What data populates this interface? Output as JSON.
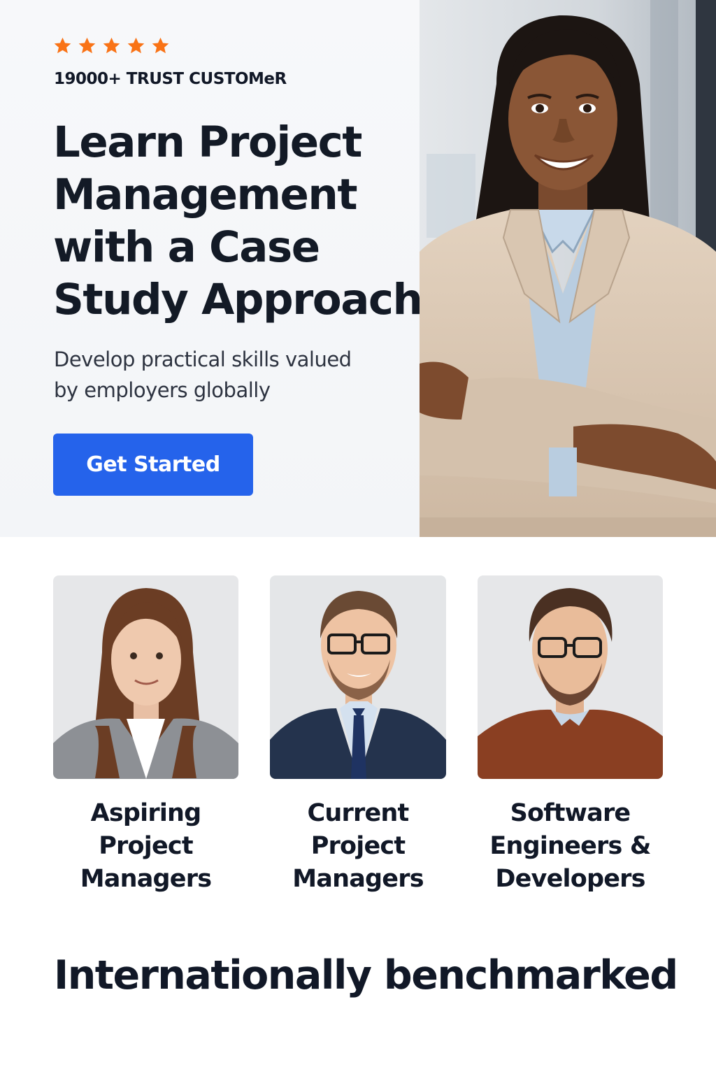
{
  "hero": {
    "rating_stars": 5,
    "star_color": "#f97316",
    "trust_text": "19000+ TRUST CUSTOMeR",
    "headline_lines": [
      "Learn Project",
      "Management",
      "with a Case",
      "Study Approach"
    ],
    "subhead_lines": [
      "Develop practical skills valued",
      "by employers globally"
    ],
    "cta_label": "Get Started",
    "cta_color": "#2563eb",
    "photo_icon": "woman-professional-portrait"
  },
  "audience": {
    "cards": [
      {
        "label_lines": [
          "Aspiring",
          "Project",
          "Managers"
        ],
        "photo_icon": "woman-gray-blazer-portrait"
      },
      {
        "label_lines": [
          "Current",
          "Project",
          "Managers"
        ],
        "photo_icon": "man-suit-glasses-portrait"
      },
      {
        "label_lines": [
          "Software",
          "Engineers &",
          "Developers"
        ],
        "photo_icon": "man-sweater-glasses-portrait"
      }
    ]
  },
  "section": {
    "title": "Internationally benchmarked"
  }
}
